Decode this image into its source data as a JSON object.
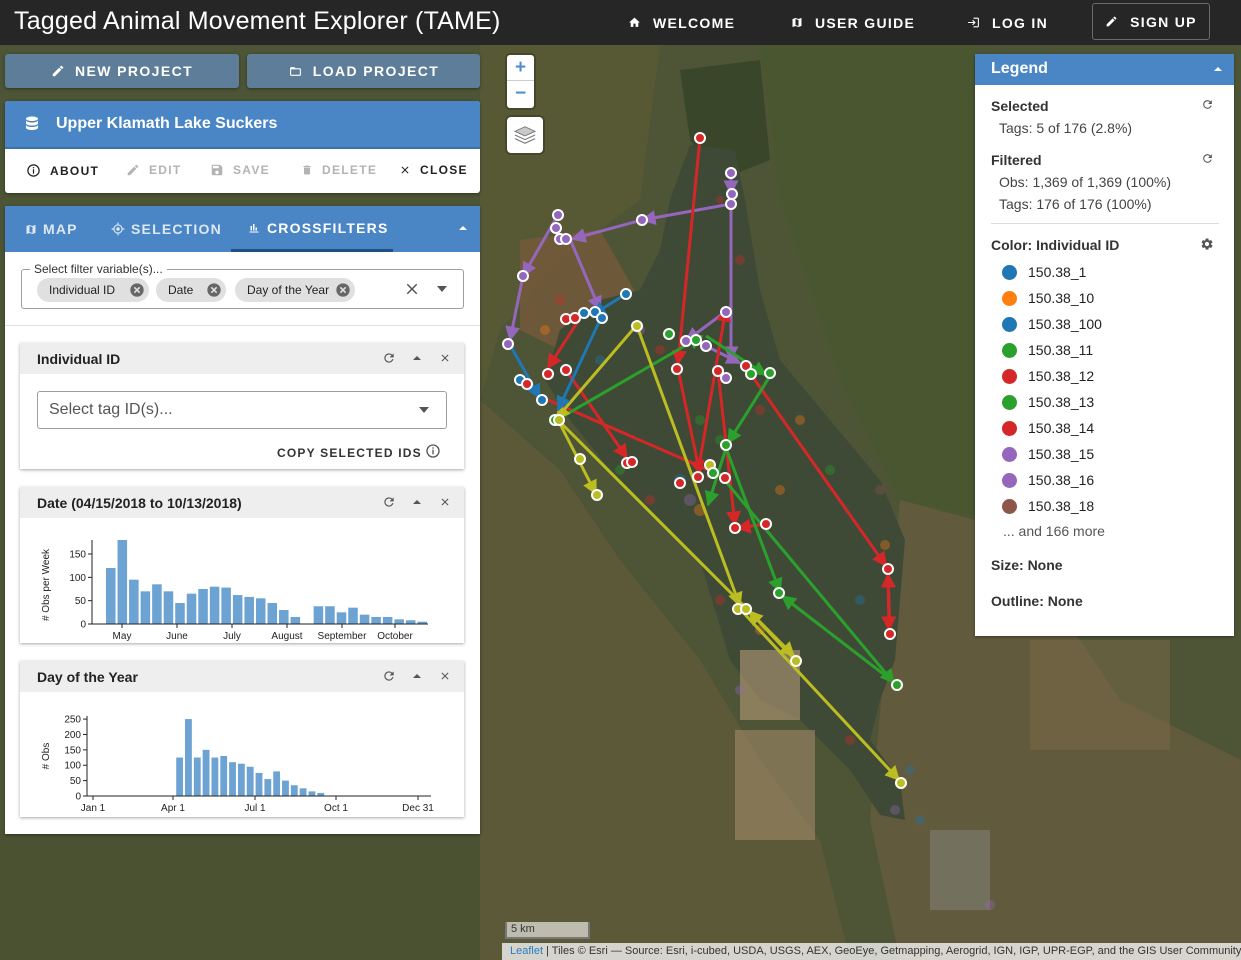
{
  "app": {
    "title": "Tagged Animal Movement Explorer (TAME)",
    "nav": {
      "welcome": "WELCOME",
      "user_guide": "USER GUIDE",
      "log_in": "LOG IN",
      "sign_up": "SIGN UP"
    }
  },
  "project": {
    "new_label": "NEW PROJECT",
    "load_label": "LOAD PROJECT",
    "name": "Upper Klamath Lake Suckers",
    "actions": {
      "about": "ABOUT",
      "edit": "EDIT",
      "save": "SAVE",
      "delete": "DELETE",
      "close": "CLOSE"
    }
  },
  "tabs": {
    "map": "MAP",
    "selection": "SELECTION",
    "crossfilters": "CROSSFILTERS",
    "active": "CROSSFILTERS"
  },
  "crossfilters": {
    "select_label": "Select filter variable(s)...",
    "chips": [
      "Individual ID",
      "Date",
      "Day of the Year"
    ],
    "individual": {
      "title": "Individual ID",
      "placeholder": "Select tag ID(s)...",
      "copy_label": "COPY SELECTED IDS"
    },
    "date": {
      "title": "Date (04/15/2018 to 10/13/2018)",
      "ylabel": "# Obs per Week",
      "yticks": [
        "150",
        "100",
        "50",
        "0"
      ],
      "xticks": [
        "May",
        "June",
        "July",
        "August",
        "September",
        "October"
      ]
    },
    "doy": {
      "title": "Day of the Year",
      "ylabel": "# Obs",
      "yticks": [
        "250",
        "200",
        "150",
        "100",
        "50",
        "0"
      ],
      "xticks": [
        "Jan 1",
        "Apr 1",
        "Jul 1",
        "Oct 1",
        "Dec 31"
      ]
    }
  },
  "chart_data": [
    {
      "type": "bar",
      "title": "Date (04/15/2018 to 10/13/2018)",
      "ylabel": "# Obs per Week",
      "ylim": [
        0,
        180
      ],
      "values": [
        120,
        180,
        95,
        70,
        85,
        70,
        45,
        65,
        75,
        80,
        78,
        62,
        58,
        55,
        45,
        30,
        15,
        0,
        38,
        38,
        25,
        35,
        20,
        15,
        15,
        10,
        8,
        5
      ]
    },
    {
      "type": "bar",
      "title": "Day of the Year",
      "ylabel": "# Obs",
      "ylim": [
        0,
        260
      ],
      "values": [
        125,
        250,
        125,
        150,
        125,
        130,
        110,
        105,
        95,
        75,
        55,
        80,
        50,
        35,
        25,
        15,
        10
      ]
    }
  ],
  "map": {
    "zoom_in": "+",
    "zoom_out": "−",
    "scale": "5 km",
    "attribution_link": "Leaflet",
    "attribution_text": " | Tiles © Esri — Source: Esri, i-cubed, USDA, USGS, AEX, GeoEye, Getmapping, Aerogrid, IGN, IGP, UPR-EGP, and the GIS User Community"
  },
  "legend": {
    "title": "Legend",
    "selected_label": "Selected",
    "selected_tags": "Tags: 5 of 176 (2.8%)",
    "filtered_label": "Filtered",
    "filtered_obs": "Obs: 1,369 of 1,369 (100%)",
    "filtered_tags": "Tags: 176 of 176 (100%)",
    "color_label": "Color: Individual ID",
    "items": [
      {
        "label": "150.38_1",
        "color": "#1f77b4"
      },
      {
        "label": "150.38_10",
        "color": "#ff7f0e"
      },
      {
        "label": "150.38_100",
        "color": "#1f77b4"
      },
      {
        "label": "150.38_11",
        "color": "#2ca02c"
      },
      {
        "label": "150.38_12",
        "color": "#d62728"
      },
      {
        "label": "150.38_13",
        "color": "#2ca02c"
      },
      {
        "label": "150.38_14",
        "color": "#d62728"
      },
      {
        "label": "150.38_15",
        "color": "#9467bd"
      },
      {
        "label": "150.38_16",
        "color": "#9467bd"
      },
      {
        "label": "150.38_18",
        "color": "#8c564b"
      }
    ],
    "more": "... and 166 more",
    "size_label": "Size: None",
    "outline_label": "Outline: None"
  },
  "colors": {
    "header": "#4a86c5",
    "project_button": "#5d7d99",
    "topbar": "#262626"
  }
}
